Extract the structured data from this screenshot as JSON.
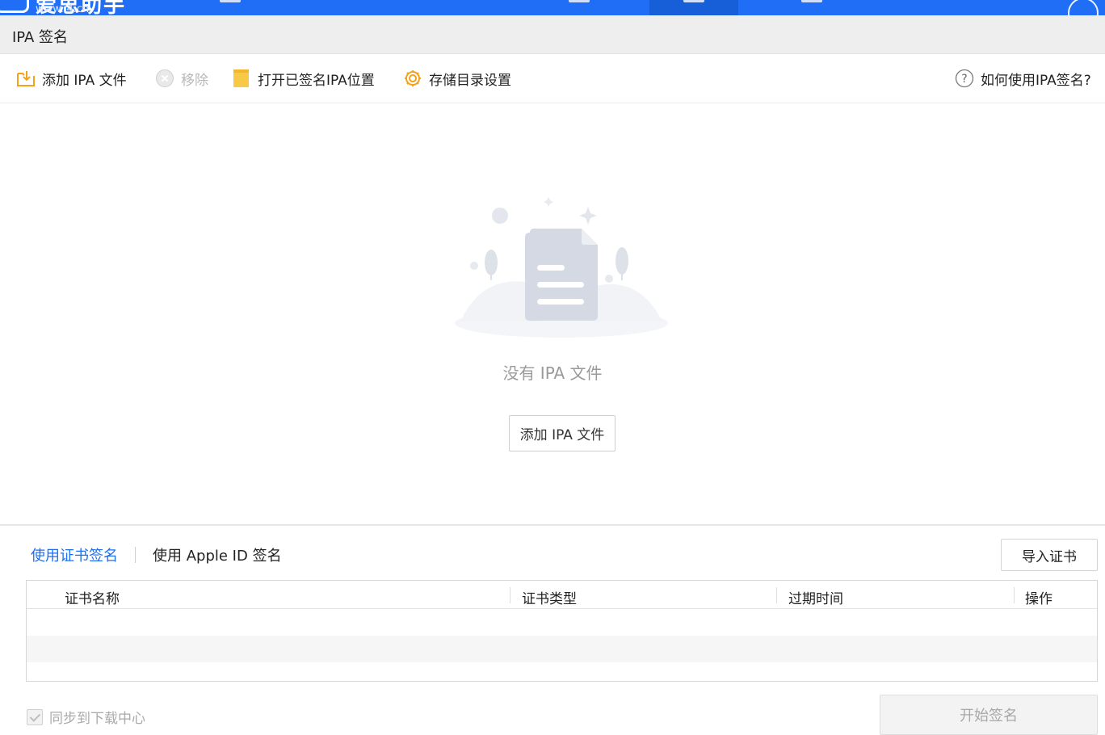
{
  "app": {
    "brand": "爱思助手",
    "brand_url": "www.i4.cn"
  },
  "window": {
    "title": "IPA 签名"
  },
  "toolbar": {
    "add_label": "添加 IPA 文件",
    "remove_label": "移除",
    "open_signed_label": "打开已签名IPA位置",
    "storage_label": "存储目录设置",
    "help_label": "如何使用IPA签名?"
  },
  "empty_state": {
    "message": "没有 IPA 文件",
    "add_button": "添加 IPA 文件"
  },
  "sign_tabs": {
    "cert_tab": "使用证书签名",
    "apple_id_tab": "使用 Apple ID 签名"
  },
  "import_cert_button": "导入证书",
  "cert_table": {
    "columns": [
      "证书名称",
      "证书类型",
      "过期时间",
      "操作"
    ]
  },
  "footer": {
    "sync_label": "同步到下载中心",
    "sync_checked": true,
    "start_sign_button": "开始签名"
  },
  "colors": {
    "brand_blue": "#1f6ef5",
    "tab_active": "#1d6ff2",
    "folder_yellow": "#f7b528"
  },
  "icons": {
    "add": "folder-add-icon",
    "remove": "remove-circle-icon",
    "open": "folder-icon",
    "storage": "gear-icon",
    "help": "question-circle-icon"
  }
}
